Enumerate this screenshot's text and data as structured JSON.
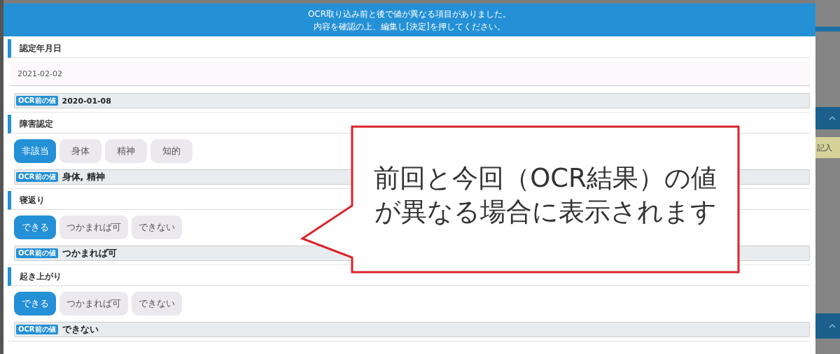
{
  "dialog": {
    "message_lines": [
      "OCR取り込み前と後で値が異なる項目がありました。",
      "内容を確認の上、編集し[決定]を押してください。"
    ]
  },
  "sections": [
    {
      "kind": "date",
      "title": "認定年月日",
      "value": "2021-02-02",
      "ocr_badge": "OCR前の値",
      "ocr_value": "2020-01-08"
    },
    {
      "kind": "choice",
      "title": "障害認定",
      "options": [
        {
          "label": "非該当",
          "selected": true
        },
        {
          "label": "身体",
          "selected": false
        },
        {
          "label": "精神",
          "selected": false
        },
        {
          "label": "知的",
          "selected": false
        }
      ],
      "ocr_badge": "OCR前の値",
      "ocr_value": "身体, 精神"
    },
    {
      "kind": "choice",
      "title": "寝返り",
      "options": [
        {
          "label": "できる",
          "selected": true
        },
        {
          "label": "つかまれば可",
          "selected": false
        },
        {
          "label": "できない",
          "selected": false
        }
      ],
      "ocr_badge": "OCR前の値",
      "ocr_value": "つかまれば可"
    },
    {
      "kind": "choice",
      "title": "起き上がり",
      "options": [
        {
          "label": "できる",
          "selected": true
        },
        {
          "label": "つかまれば可",
          "selected": false
        },
        {
          "label": "できない",
          "selected": false
        }
      ],
      "ocr_badge": "OCR前の値",
      "ocr_value": "できない"
    }
  ],
  "callout": {
    "lines": [
      "前回と今回（OCR結果）の値",
      "が異なる場合に表示されます"
    ]
  },
  "background": {
    "button_label": "記入"
  }
}
